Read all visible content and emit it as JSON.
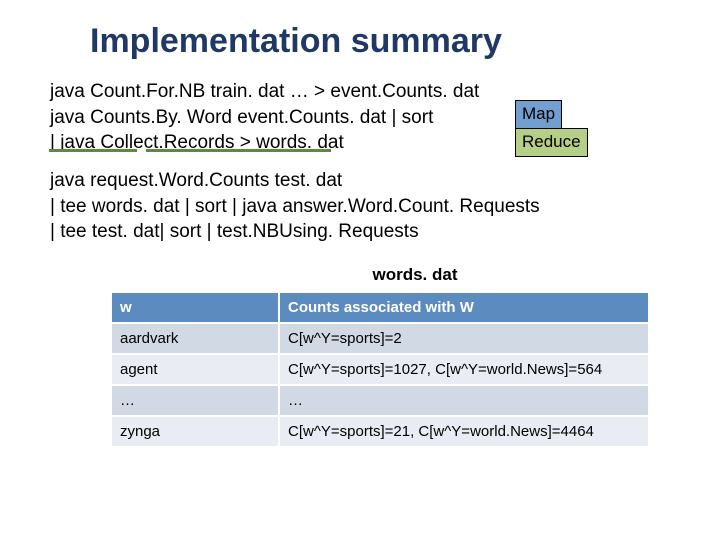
{
  "title": "Implementation summary",
  "code1": {
    "l1": "java Count.For.NB train. dat … > event.Counts. dat",
    "l2": "java Counts.By. Word event.Counts. dat | sort",
    "l3": "| java Collect.Records   > words. dat"
  },
  "badges": {
    "map": "Map",
    "reduce": "Reduce"
  },
  "code2": {
    "l1": "java request.Word.Counts  test. dat",
    "l2": "| tee words. dat | sort | java answer.Word.Count. Requests",
    "l3": "| tee test. dat| sort | test.NBUsing. Requests"
  },
  "table": {
    "caption": "words. dat",
    "headers": {
      "c0": "w",
      "c1": "Counts associated with W"
    },
    "rows": [
      {
        "c0": "aardvark",
        "c1": "C[w^Y=sports]=2"
      },
      {
        "c0": "agent",
        "c1": "C[w^Y=sports]=1027, C[w^Y=world.News]=564"
      },
      {
        "c0": "…",
        "c1": "…"
      },
      {
        "c0": "zynga",
        "c1": "C[w^Y=sports]=21, C[w^Y=world.News]=4464"
      }
    ]
  }
}
